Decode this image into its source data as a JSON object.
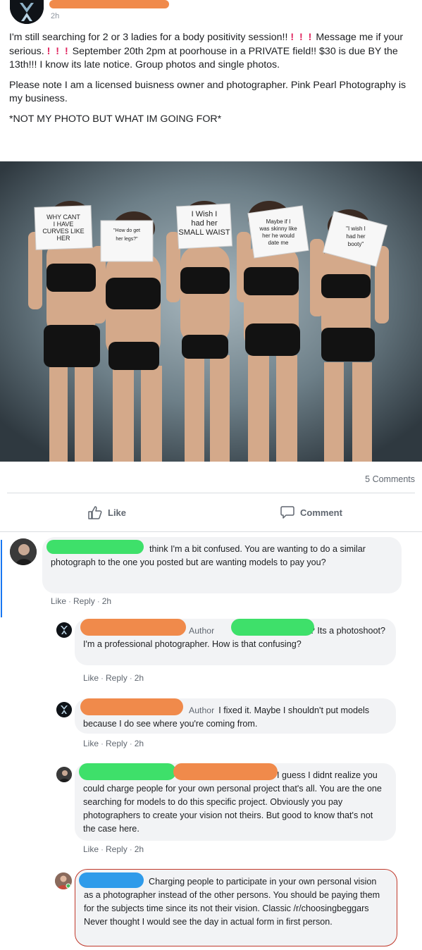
{
  "post": {
    "time": "2h",
    "paragraph1_parts": [
      "I'm still searching for 2 or 3 ladies for a body positivity session!! ",
      "! ! !",
      " Message me if your serious. ",
      "! ! !",
      " September 20th 2pm at poorhouse in a PRIVATE field!! $30 is due BY the 13th!!! I know its late notice. Group photos and single photos."
    ],
    "paragraph2": "Please note I am a licensed buisness owner and photographer. Pink Pearl Photography is my business.",
    "paragraph3": "*NOT MY PHOTO BUT WHAT IM GOING FOR*",
    "sign_texts": [
      "WHY CANT I HAVE CURVES LIKE HER",
      "\"How do get her legs?\"",
      "I Wish I had her SMALL WAIST",
      "Maybe if I was skinny like her he would date me",
      "\"I wish I had her booty\""
    ],
    "comments_count": "5 Comments",
    "like_label": "Like",
    "comment_label": "Comment"
  },
  "comments": [
    {
      "text": "think I'm a bit confused. You are wanting to do a similar photograph to the one you posted but are wanting models to pay you?",
      "like": "Like",
      "reply": "Reply",
      "time": "2h"
    },
    {
      "author_tag": "Author",
      "text_a": "yes? Its a",
      "text_b": "photoshoot? I'm a professional photographer. How is that confusing?",
      "like": "Like",
      "reply": "Reply",
      "time": "2h"
    },
    {
      "author_tag": "Author",
      "text": "I fixed it. Maybe I shouldn't put models because I do see where you're coming from.",
      "like": "Like",
      "reply": "Reply",
      "time": "2h"
    },
    {
      "text": "I guess I didnt realize you could charge people for your own personal project that's all. You are the one searching for models to do this specific project. Obviously you pay photographers to create your vision not theirs. But good to know that's not the case here.",
      "like": "Like",
      "reply": "Reply",
      "time": "2h"
    },
    {
      "text": "Charging people to participate in your own personal vision as a photographer instead of the other persons. You should be paying them for the subjects time since its not their vision. Classic /r/choosingbeggars Never thought I would see the day in actual form in first person."
    }
  ],
  "colors": {
    "exclamation": "#e0245e",
    "redact_orange": "#f08a4b",
    "redact_green": "#3ee06a",
    "redact_blue": "#2f9bea",
    "thread_line": "#1877f2",
    "highlight_border": "#c0392b"
  }
}
